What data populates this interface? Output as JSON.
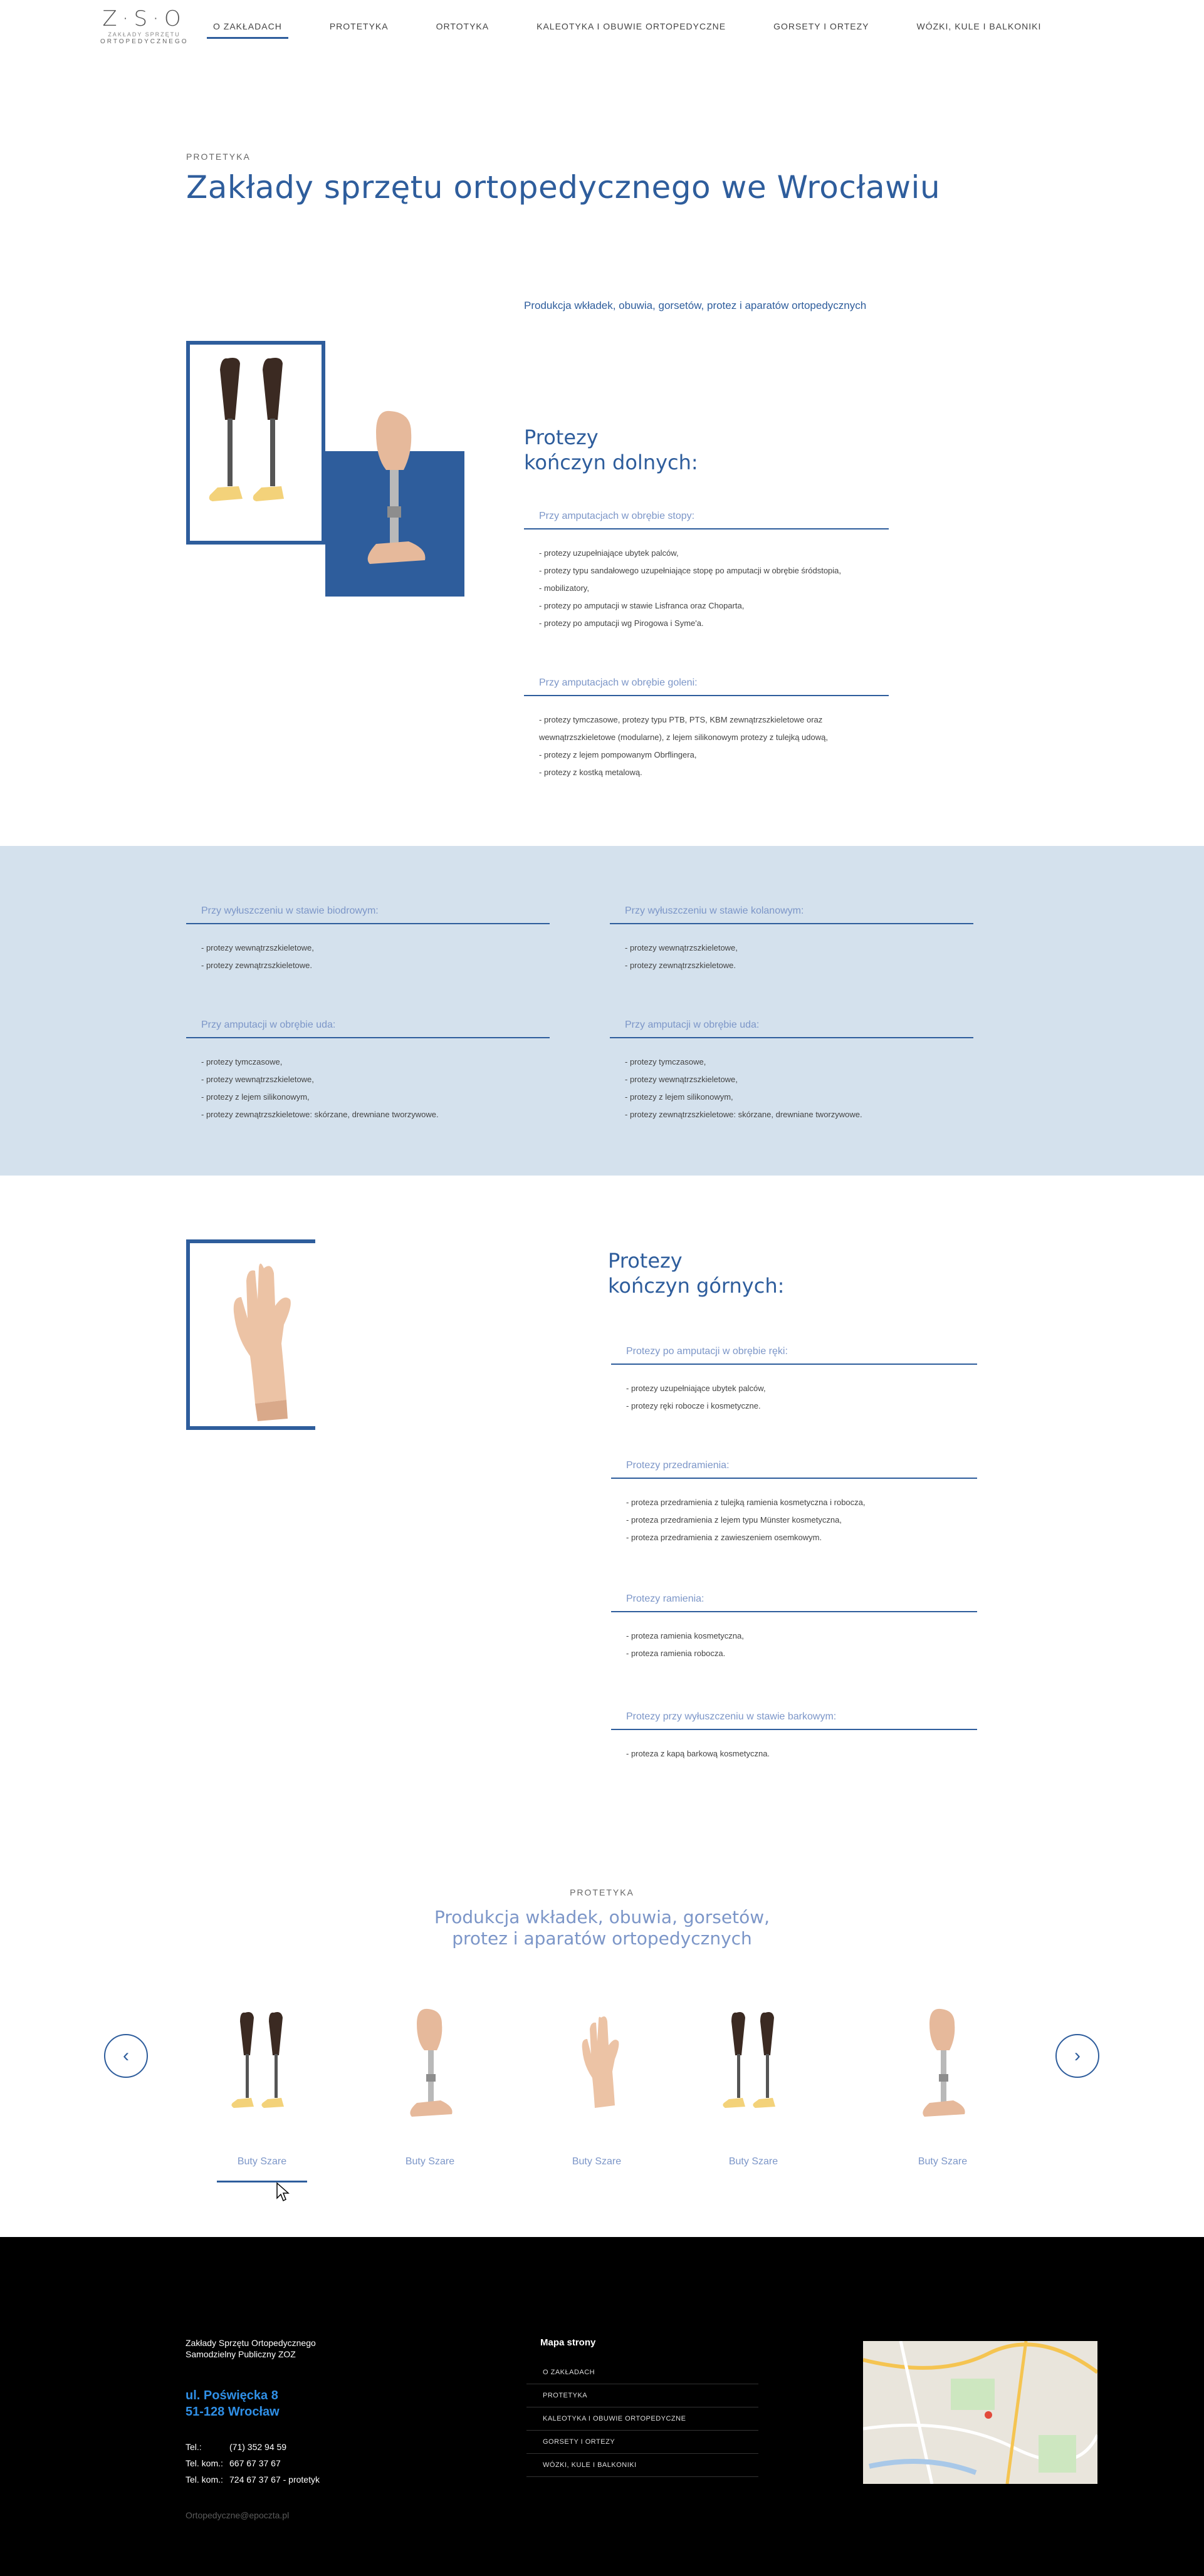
{
  "nav": {
    "logo_mark": "Z·S·O",
    "logo_sub": "ZAKŁADY SPRZĘTU",
    "logo_sub2": "ORTOPEDYCZNEGO",
    "items": [
      {
        "label": "O ZAKŁADACH",
        "active": true
      },
      {
        "label": "PROTETYKA",
        "active": false
      },
      {
        "label": "ORTOTYKA",
        "active": false
      },
      {
        "label": "KALEOTYKA I OBUWIE ORTOPEDYCZNE",
        "active": false
      },
      {
        "label": "GORSETY I ORTEZY",
        "active": false
      },
      {
        "label": "WÓZKI, KULE I BALKONIKI",
        "active": false
      }
    ]
  },
  "hero": {
    "eyebrow": "PROTETYKA",
    "title": "Zakłady sprzętu ortopedycznego we Wrocławiu",
    "intro": "Produkcja wkładek, obuwia, gorsetów, protez i aparatów ortopedycznych"
  },
  "lower_limbs": {
    "title_line1": "Protezy",
    "title_line2": "kończyn dolnych:",
    "categories": [
      {
        "head": "Przy amputacjach w obrębie stopy:",
        "items": [
          "- protezy uzupełniające ubytek palców,",
          "- protezy typu sandałowego uzupełniające stopę po amputacji w obrębie śródstopia,",
          "- mobilizatory,",
          "- protezy po amputacji w stawie Lisfranca oraz Choparta,",
          "- protezy po amputacji wg Pirogowa i Syme'a."
        ]
      },
      {
        "head": "Przy amputacjach w obrębie goleni:",
        "items": [
          "- protezy tymczasowe, protezy typu PTB, PTS, KBM zewnątrzszkieletowe oraz",
          "wewnątrzszkieletowe (modularne), z lejem silikonowym protezy z tulejką udową,",
          "- protezy z lejem pompowanym Obrflingera,",
          "- protezy z kostką metalową."
        ]
      }
    ]
  },
  "band": {
    "categories": [
      {
        "head": "Przy wyłuszczeniu w stawie biodrowym:",
        "items": [
          "- protezy wewnątrzszkieletowe,",
          "- protezy zewnątrzszkieletowe."
        ]
      },
      {
        "head": "Przy wyłuszczeniu w stawie kolanowym:",
        "items": [
          "- protezy wewnątrzszkieletowe,",
          "- protezy zewnątrzszkieletowe."
        ]
      },
      {
        "head": "Przy amputacji w obrębie uda:",
        "items": [
          "- protezy tymczasowe,",
          "- protezy wewnątrzszkieletowe,",
          "- protezy z lejem silikonowym,",
          "- protezy zewnątrzszkieletowe: skórzane, drewniane tworzywowe."
        ]
      },
      {
        "head": "Przy amputacji w obrębie uda:",
        "items": [
          "- protezy tymczasowe,",
          "- protezy wewnątrzszkieletowe,",
          "- protezy z lejem silikonowym,",
          "- protezy zewnątrzszkieletowe: skórzane, drewniane tworzywowe."
        ]
      }
    ]
  },
  "upper_limbs": {
    "title_line1": "Protezy",
    "title_line2": "kończyn górnych:",
    "categories": [
      {
        "head": "Protezy po amputacji w obrębie ręki:",
        "items": [
          "- protezy uzupełniające ubytek palców,",
          "- protezy ręki robocze i kosmetyczne."
        ]
      },
      {
        "head": "Protezy przedramienia:",
        "items": [
          "- proteza przedramienia z tulejką ramienia kosmetyczna i robocza,",
          "- proteza przedramienia z lejem typu Münster kosmetyczna,",
          "- proteza przedramienia z zawieszeniem osemkowym."
        ]
      },
      {
        "head": "Protezy ramienia:",
        "items": [
          "- proteza ramienia kosmetyczna,",
          "- proteza ramienia robocza."
        ]
      },
      {
        "head": "Protezy przy wyłuszczeniu w stawie barkowym:",
        "items": [
          "- proteza z kapą barkową kosmetyczna."
        ]
      }
    ]
  },
  "carousel": {
    "eyebrow": "PROTETYKA",
    "title_line1": "Produkcja wkładek, obuwia, gorsetów,",
    "title_line2": "protez i aparatów ortopedycznych",
    "prev": "‹",
    "next": "›",
    "items": [
      {
        "label": "Buty Szare",
        "kind": "legs-pair"
      },
      {
        "label": "Buty Szare",
        "kind": "leg-single"
      },
      {
        "label": "Buty Szare",
        "kind": "hand"
      },
      {
        "label": "Buty Szare",
        "kind": "legs-pair"
      },
      {
        "label": "Buty Szare",
        "kind": "leg-single"
      }
    ]
  },
  "footer": {
    "company_line1": "Zakłady Sprzętu Ortopedycznego",
    "company_line2": "Samodzielny Publiczny ZOZ",
    "address_line1": "ul. Poświęcka 8",
    "address_line2": "51-128 Wrocław",
    "contacts": [
      {
        "label": "Tel.:",
        "value": "(71) 352 94 59"
      },
      {
        "label": "Tel. kom.:",
        "value": "667 67 37 67"
      },
      {
        "label": "Tel. kom.:",
        "value": "724 67 37 67 - protetyk"
      }
    ],
    "email": "Ortopedyczne@epoczta.pl",
    "sitemap_title": "Mapa strony",
    "sitemap": [
      "O ZAKŁADACH",
      "PROTETYKA",
      "KALEOTYKA I OBUWIE ORTOPEDYCZNE",
      "GORSETY I ORTEZY",
      "WÓZKI, KULE I BALKONIKI"
    ]
  },
  "colors": {
    "brand": "#2e5d9c",
    "band": "#d4e1ed",
    "footer_accent": "#2f8fe6",
    "muted_head": "#7c96c8"
  }
}
